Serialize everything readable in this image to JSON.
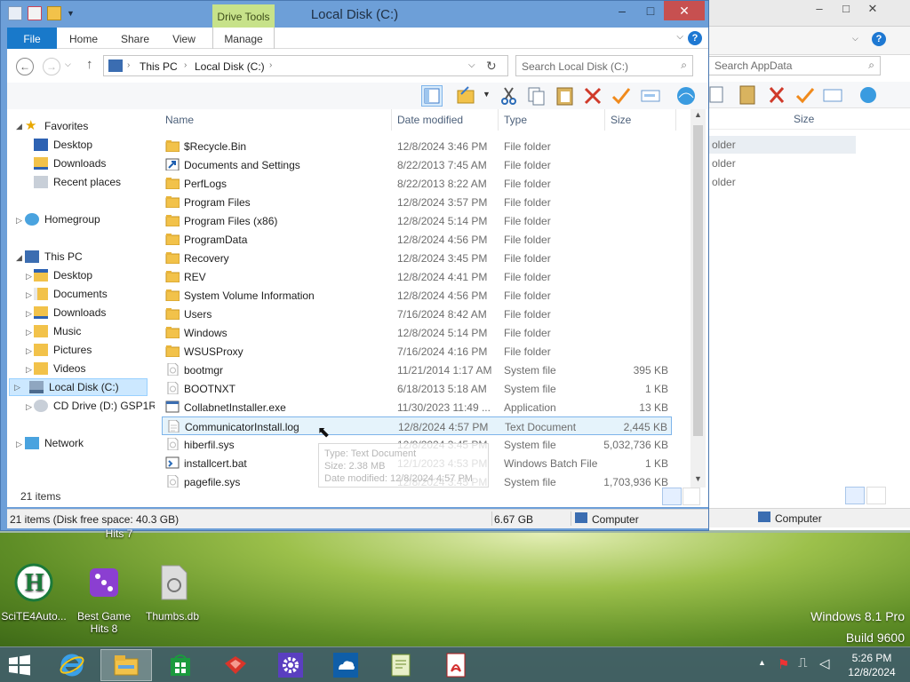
{
  "window": {
    "title": "Local Disk (C:)",
    "contextual_tab": "Drive Tools",
    "tabs": [
      "File",
      "Home",
      "Share",
      "View",
      "Manage"
    ],
    "minimize": "–",
    "maximize": "□",
    "close": "✕",
    "help": "?"
  },
  "address": {
    "crumbs": [
      "This PC",
      "Local Disk (C:)"
    ],
    "search_placeholder": "Search Local Disk (C:)"
  },
  "nav": {
    "favorites_label": "Favorites",
    "favorites": [
      "Desktop",
      "Downloads",
      "Recent places"
    ],
    "homegroup": "Homegroup",
    "thispc_label": "This PC",
    "thispc_items": [
      "Desktop",
      "Documents",
      "Downloads",
      "Music",
      "Pictures",
      "Videos",
      "Local Disk (C:)",
      "CD Drive (D:) GSP1R"
    ],
    "network": "Network",
    "selected": "Local Disk (C:)"
  },
  "columns": {
    "name": "Name",
    "date": "Date modified",
    "type": "Type",
    "size": "Size"
  },
  "files": [
    {
      "name": "$Recycle.Bin",
      "date": "12/8/2024 3:46 PM",
      "type": "File folder",
      "size": "",
      "icon": "folder-icon"
    },
    {
      "name": "Documents and Settings",
      "date": "8/22/2013 7:45 AM",
      "type": "File folder",
      "size": "",
      "icon": "shortcut-folder-icon"
    },
    {
      "name": "PerfLogs",
      "date": "8/22/2013 8:22 AM",
      "type": "File folder",
      "size": "",
      "icon": "folder-icon"
    },
    {
      "name": "Program Files",
      "date": "12/8/2024 3:57 PM",
      "type": "File folder",
      "size": "",
      "icon": "folder-icon"
    },
    {
      "name": "Program Files (x86)",
      "date": "12/8/2024 5:14 PM",
      "type": "File folder",
      "size": "",
      "icon": "folder-icon"
    },
    {
      "name": "ProgramData",
      "date": "12/8/2024 4:56 PM",
      "type": "File folder",
      "size": "",
      "icon": "folder-icon"
    },
    {
      "name": "Recovery",
      "date": "12/8/2024 3:45 PM",
      "type": "File folder",
      "size": "",
      "icon": "folder-icon"
    },
    {
      "name": "REV",
      "date": "12/8/2024 4:41 PM",
      "type": "File folder",
      "size": "",
      "icon": "folder-icon"
    },
    {
      "name": "System Volume Information",
      "date": "12/8/2024 4:56 PM",
      "type": "File folder",
      "size": "",
      "icon": "folder-icon"
    },
    {
      "name": "Users",
      "date": "7/16/2024 8:42 AM",
      "type": "File folder",
      "size": "",
      "icon": "folder-icon"
    },
    {
      "name": "Windows",
      "date": "12/8/2024 5:14 PM",
      "type": "File folder",
      "size": "",
      "icon": "folder-icon"
    },
    {
      "name": "WSUSProxy",
      "date": "7/16/2024 4:16 PM",
      "type": "File folder",
      "size": "",
      "icon": "folder-icon"
    },
    {
      "name": "bootmgr",
      "date": "11/21/2014 1:17 AM",
      "type": "System file",
      "size": "395 KB",
      "icon": "system-file-icon"
    },
    {
      "name": "BOOTNXT",
      "date": "6/18/2013 5:18 AM",
      "type": "System file",
      "size": "1 KB",
      "icon": "system-file-icon"
    },
    {
      "name": "CollabnetInstaller.exe",
      "date": "11/30/2023 11:49 ...",
      "type": "Application",
      "size": "13 KB",
      "icon": "application-icon"
    },
    {
      "name": "CommunicatorInstall.log",
      "date": "12/8/2024 4:57 PM",
      "type": "Text Document",
      "size": "2,445 KB",
      "icon": "text-document-icon"
    },
    {
      "name": "hiberfil.sys",
      "date": "12/8/2024 3:45 PM",
      "type": "System file",
      "size": "5,032,736 KB",
      "icon": "system-file-icon"
    },
    {
      "name": "installcert.bat",
      "date": "12/1/2023 4:53 PM",
      "type": "Windows Batch File",
      "size": "1 KB",
      "icon": "batch-file-icon"
    },
    {
      "name": "pagefile.sys",
      "date": "12/8/2024 3:45 PM",
      "type": "System file",
      "size": "1,703,936 KB",
      "icon": "system-file-icon"
    }
  ],
  "hovered_file": "CommunicatorInstall.log",
  "tooltip": {
    "line1": "Type: Text Document",
    "line2": "Size: 2.38 MB",
    "line3": "Date modified: 12/8/2024 4:57 PM"
  },
  "items_count": "21 items",
  "status": {
    "left": "21 items (Disk free space: 40.3 GB)",
    "size": "6.67 GB",
    "computer": "Computer"
  },
  "bg_window": {
    "search_placeholder": "Search AppData",
    "size_header": "Size",
    "rows": [
      "older",
      "older",
      "older"
    ],
    "computer": "Computer"
  },
  "desktop_icons": [
    {
      "label": "SciTE4Auto...",
      "icon": "scite-icon"
    },
    {
      "label": "Best Game Hits 8",
      "icon": "game-dice-icon"
    },
    {
      "label": "Thumbs.db",
      "icon": "thumbs-db-icon"
    }
  ],
  "desktop_partial_label": "Hits 7",
  "brand": {
    "line1": "Windows 8.1 Pro",
    "line2": "Build 9600"
  },
  "clock": {
    "time": "5:26 PM",
    "date": "12/8/2024"
  },
  "taskbar_apps": [
    "start-icon",
    "internet-explorer-icon",
    "file-explorer-icon",
    "store-icon",
    "app-red-icon",
    "settings-icon",
    "onedrive-icon",
    "notepad-plus-icon",
    "acrobat-icon"
  ],
  "colors": {
    "accent": "#1979ca",
    "title_bar": "#6d9fd8",
    "selection": "#cce8ff",
    "drive_tools": "#c7e28a"
  }
}
